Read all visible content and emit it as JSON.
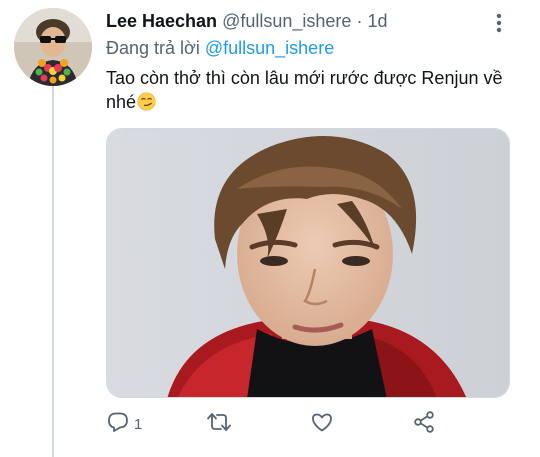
{
  "tweet": {
    "display_name": "Lee Haechan",
    "handle": "@fullsun_ishere",
    "separator": "·",
    "time": "1d",
    "reply_prefix": "Đang trả lời",
    "reply_to": "@fullsun_ishere",
    "text": "Tao còn thở thì còn lâu mới rước được Renjun về nhé",
    "text_emoji": "smirking-face-emoji"
  },
  "actions": {
    "reply_icon": "reply-icon",
    "reply_count": "1",
    "retweet_icon": "retweet-icon",
    "like_icon": "heart-icon",
    "share_icon": "share-icon"
  },
  "colors": {
    "accent": "#1d9bf0",
    "secondary_text": "#536471",
    "primary_text": "#0f1419",
    "thread_line": "#cfd9de"
  }
}
